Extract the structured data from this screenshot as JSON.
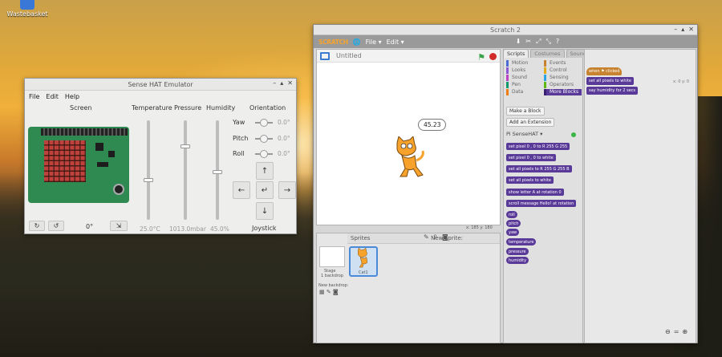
{
  "desktop": {
    "icon_label": "Wastebasket"
  },
  "sense_hat": {
    "title": "Sense HAT Emulator",
    "menu": [
      "File",
      "Edit",
      "Help"
    ],
    "headers": {
      "screen": "Screen",
      "temperature": "Temperature",
      "pressure": "Pressure",
      "humidity": "Humidity",
      "orientation": "Orientation"
    },
    "values": {
      "temperature": "25.0°C",
      "pressure": "1013.0mbar",
      "humidity": "45.0%"
    },
    "orientation": {
      "yaw": "Yaw",
      "pitch": "Pitch",
      "roll": "Roll",
      "yaw_val": "0.0°",
      "pitch_val": "0.0°",
      "roll_val": "0.0°"
    },
    "rotation_value": "0°",
    "joystick_label": "Joystick",
    "buttons": {
      "rotate_ccw": "↻",
      "rotate_cw": "↺",
      "collapse": "⇲",
      "up": "↑",
      "left": "←",
      "enter": "↵",
      "right": "→",
      "down": "↓"
    }
  },
  "scratch": {
    "title": "Scratch 2",
    "menu": {
      "logo": "SCRATCH",
      "file": "File ▾",
      "edit": "Edit ▾"
    },
    "stage": {
      "project_title": "Untitled",
      "bubble": "45.23",
      "coords": "x: 185  y: 180"
    },
    "tabs": [
      "Scripts",
      "Costumes",
      "Sounds"
    ],
    "categories": [
      "Motion",
      "Events",
      "Looks",
      "Control",
      "Sound",
      "Sensing",
      "Pen",
      "Operators",
      "Data",
      "More Blocks"
    ],
    "palette": {
      "make_block": "Make a Block",
      "add_extension": "Add an Extension",
      "extension_name": "Pi SenseHAT ▾",
      "blocks": [
        "set pixel 0 , 0 to R 255 G 255",
        "set pixel 0 , 0 to white",
        "set all pixels to R 255 G 255 B",
        "set all pixels to white",
        "show letter A at rotation 0",
        "scroll message Hello! at rotation",
        "roll",
        "pitch",
        "yaw",
        "temperature",
        "pressure",
        "humidity"
      ]
    },
    "sprites_pane": {
      "header": "Sprites",
      "new_sprite": "New sprite:",
      "stage_label": "Stage",
      "stage_backdrop": "1 backdrop",
      "new_backdrop": "New backdrop:",
      "sprite_name": "Cat1"
    },
    "script": {
      "hat": "when ⚑ clicked",
      "b1": "set all pixels to white",
      "b2": "say humidity for 2 secs"
    },
    "script_coords": "x: 0\ny: 0",
    "zoom": [
      "🔍",
      "=",
      "🔍"
    ]
  }
}
